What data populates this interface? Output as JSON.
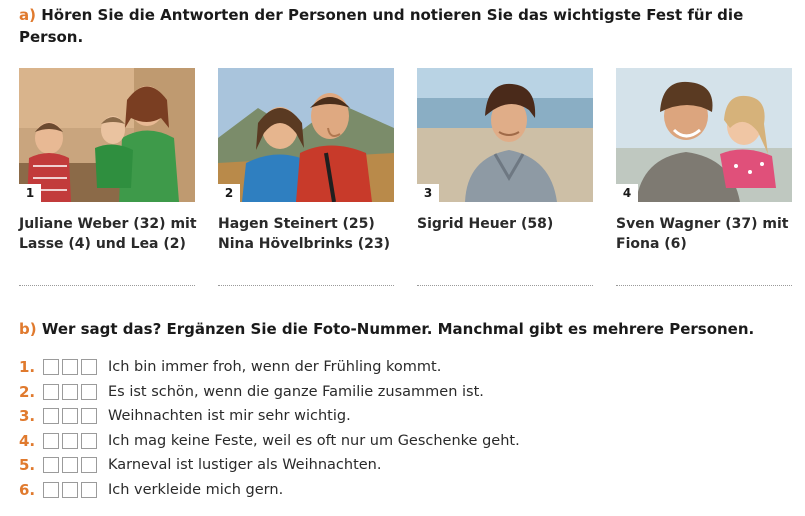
{
  "task_a": {
    "letter": "a)",
    "instruction": "Hören Sie die Antworten der Personen und notieren Sie das wichtigste Fest für die Person."
  },
  "photos": [
    {
      "number": "1",
      "caption_line1": "Juliane Weber (32) mit",
      "caption_line2": "Lasse (4) und Lea (2)"
    },
    {
      "number": "2",
      "caption_line1": "Hagen Steinert (25)",
      "caption_line2": "Nina Hövelbrinks (23)"
    },
    {
      "number": "3",
      "caption_line1": "Sigrid Heuer (58)",
      "caption_line2": ""
    },
    {
      "number": "4",
      "caption_line1": "Sven Wagner (37) mit",
      "caption_line2": "Fiona (6)"
    }
  ],
  "task_b": {
    "letter": "b)",
    "instruction": "Wer sagt das? Ergänzen Sie die Foto-Nummer. Manchmal gibt es mehrere Personen."
  },
  "statements": [
    {
      "number": "1.",
      "text": "Ich bin immer froh, wenn der Frühling kommt."
    },
    {
      "number": "2.",
      "text": "Es ist schön, wenn die ganze Familie zusammen ist."
    },
    {
      "number": "3.",
      "text": "Weihnachten ist mir sehr wichtig."
    },
    {
      "number": "4.",
      "text": "Ich mag keine Feste, weil es oft nur um Geschenke geht."
    },
    {
      "number": "5.",
      "text": "Karneval ist lustiger als Weihnachten."
    },
    {
      "number": "6.",
      "text": "Ich verkleide mich gern."
    }
  ],
  "colors": {
    "accent": "#e07a2e",
    "text": "#1a1a1a"
  }
}
